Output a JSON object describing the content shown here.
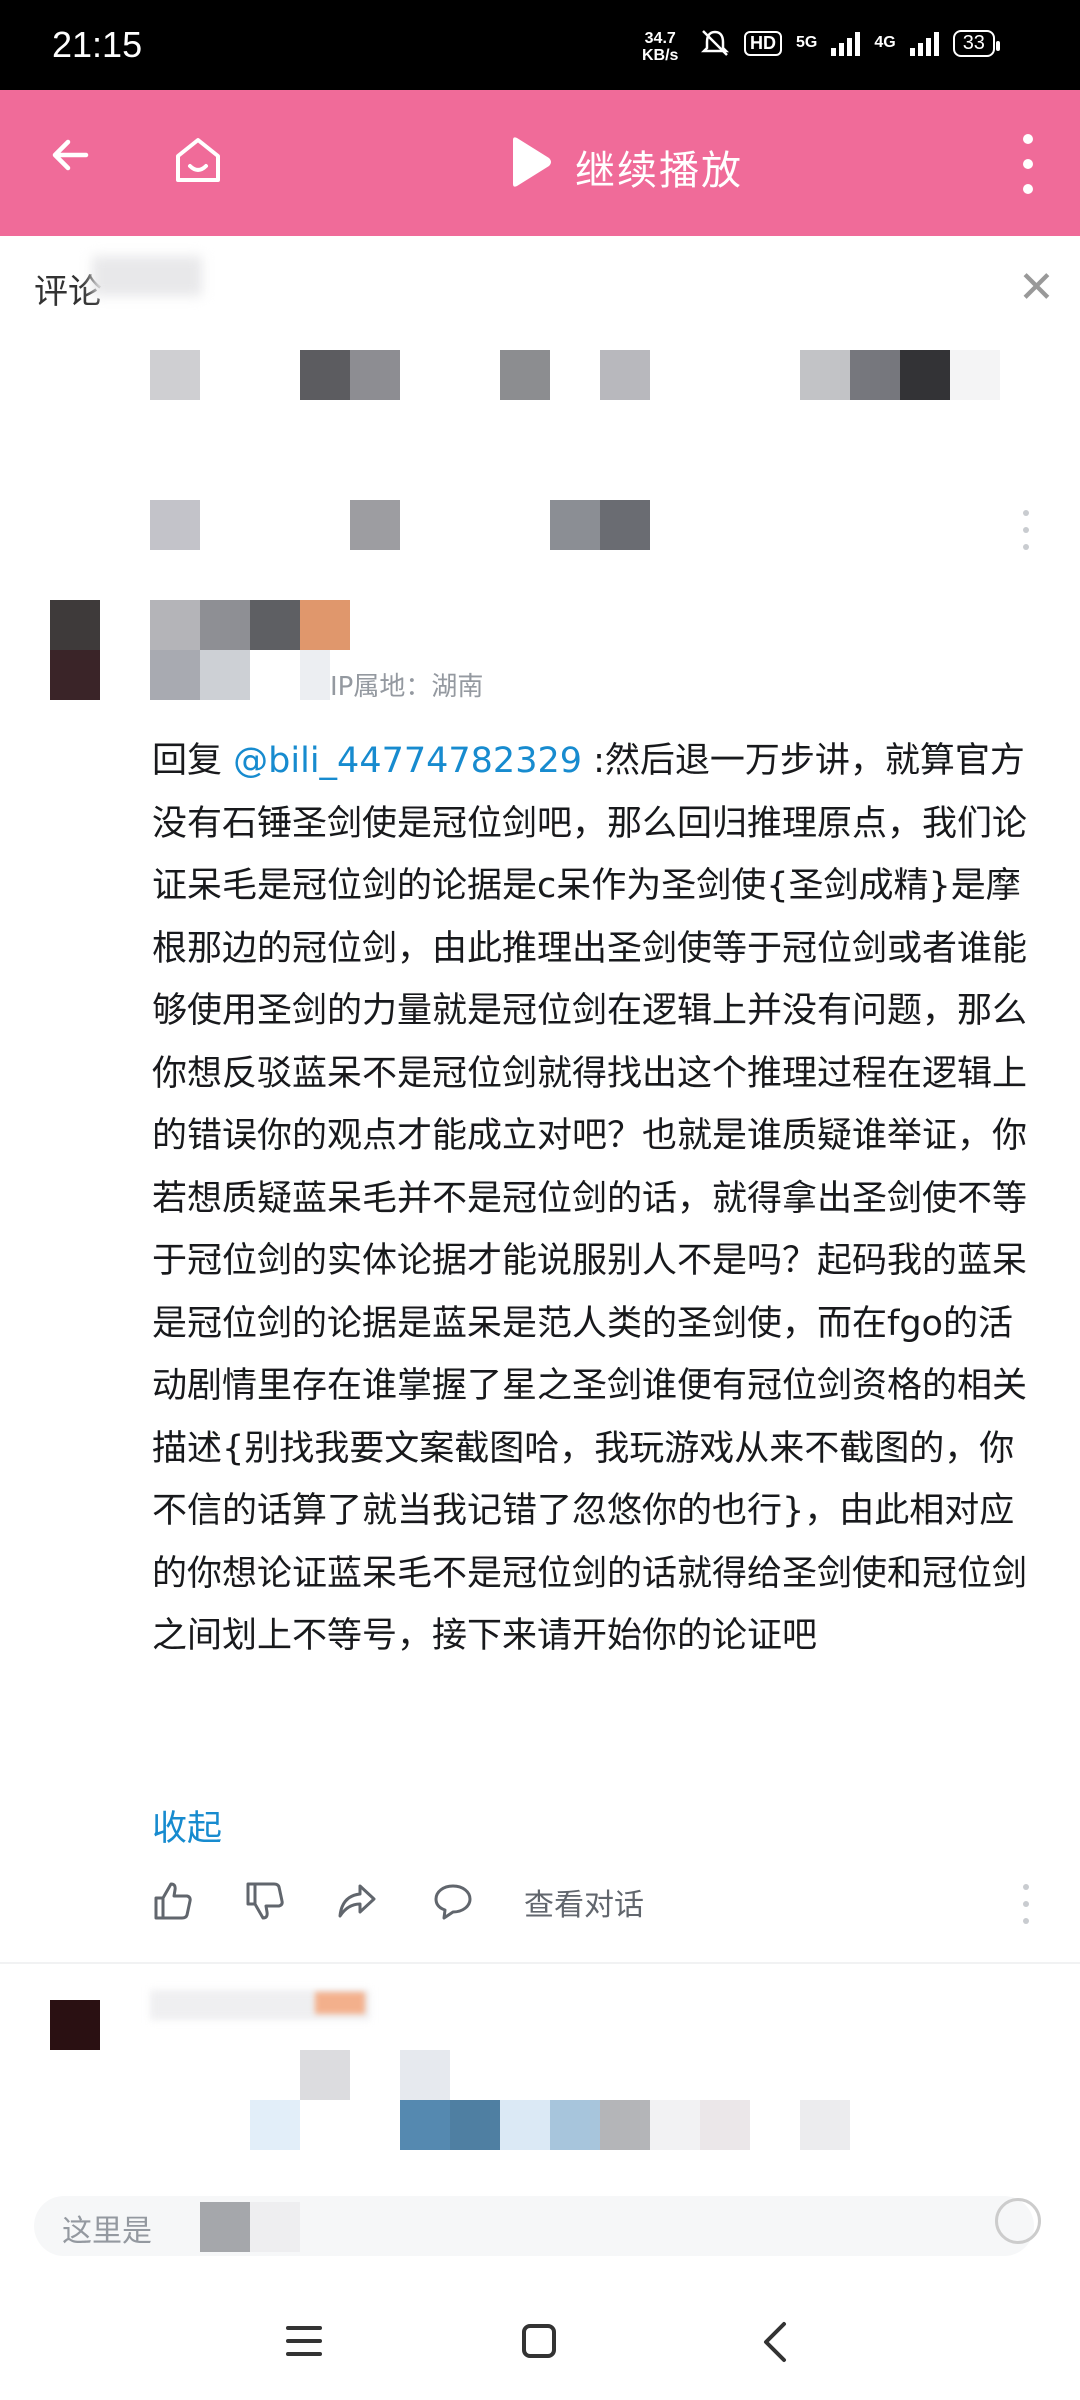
{
  "status_bar": {
    "time": "21:15",
    "speed_value": "34.7",
    "speed_unit": "KB/s",
    "hd_label": "HD",
    "net1": "5G",
    "net2": "4G",
    "battery": "33"
  },
  "app_bar": {
    "back_icon": "arrow-left-icon",
    "home_icon": "home-icon",
    "play_icon": "play-icon",
    "title": "继续播放",
    "more_icon": "more-vertical-icon",
    "color": "#f06b99"
  },
  "panel": {
    "label": "评论",
    "close_icon": "close-icon"
  },
  "comment": {
    "location": "IP属地：湖南",
    "reply_prefix": "回复",
    "mention": "@bili_44774782329",
    "text": " :然后退一万步讲，就算官方没有石锤圣剑使是冠位剑吧，那么回归推理原点，我们论证呆毛是冠位剑的论据是c呆作为圣剑使{圣剑成精}是摩根那边的冠位剑，由此推理出圣剑使等于冠位剑或者谁能够使用圣剑的力量就是冠位剑在逻辑上并没有问题，那么你想反驳蓝呆不是冠位剑就得找出这个推理过程在逻辑上的错误你的观点才能成立对吧？也就是谁质疑谁举证，你若想质疑蓝呆毛并不是冠位剑的话，就得拿出圣剑使不等于冠位剑的实体论据才能说服别人不是吗？起码我的蓝呆是冠位剑的论据是蓝呆是范人类的圣剑使，而在fgo的活动剧情里存在谁掌握了星之圣剑谁便有冠位剑资格的相关描述{别找我要文案截图哈，我玩游戏从来不截图的，你不信的话算了就当我记错了忽悠你的也行}，由此相对应的你想论证蓝呆毛不是冠位剑的话就得给圣剑使和冠位剑之间划上不等号，接下来请开始你的论证吧",
    "collapse_label": "收起",
    "view_conversation": "查看对话",
    "mention_color": "#178bcf"
  },
  "actions": {
    "like_icon": "thumbs-up-icon",
    "dislike_icon": "thumbs-down-icon",
    "share_icon": "share-icon",
    "reply_icon": "comment-bubble-icon"
  },
  "input": {
    "placeholder": "这里是"
  },
  "nav_bar": {
    "menu_icon": "menu-icon",
    "home_icon": "square-icon",
    "back_icon": "chevron-left-icon"
  }
}
